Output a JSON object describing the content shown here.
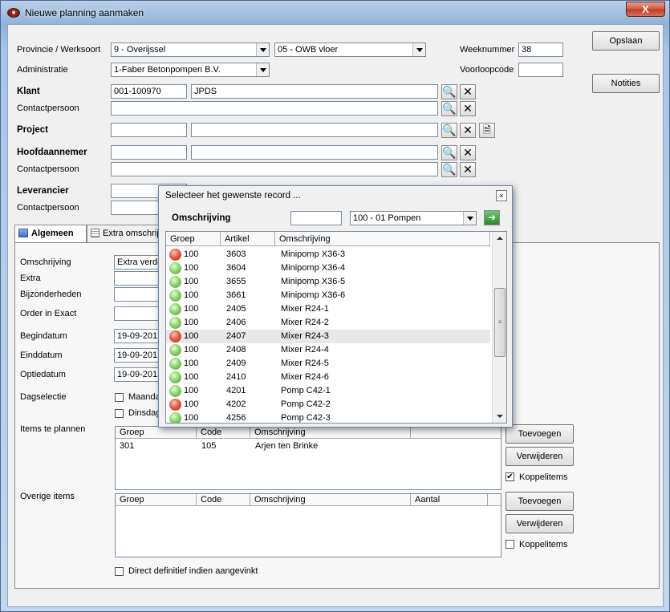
{
  "window": {
    "title": "Nieuwe planning aanmaken",
    "close": "X"
  },
  "form": {
    "provincie_label": "Provincie / Werksoort",
    "provincie_value": "9 - Overijssel",
    "werksoort_value": "05 - OWB vloer",
    "weeknummer_label": "Weeknummer",
    "weeknummer_value": "38",
    "administratie_label": "Administratie",
    "administratie_value": "1-Faber Betonpompen B.V.",
    "voorloopcode_label": "Voorloopcode",
    "klant_label": "Klant",
    "klant_code": "001-100970",
    "klant_name": "JPDS",
    "contactpersoon_label": "Contactpersoon",
    "project_label": "Project",
    "hoofdaannemer_label": "Hoofdaannemer",
    "leverancier_label": "Leverancier"
  },
  "side_buttons": {
    "opslaan": "Opslaan",
    "notities": "Notities"
  },
  "tabs": [
    {
      "label": "Algemeen"
    },
    {
      "label": "Extra omschrijv"
    }
  ],
  "general": {
    "omschrijving_label": "Omschrijving",
    "omschrijving_value": "Extra verdie",
    "extra_label": "Extra",
    "bijzonderheden_label": "Bijzonderheden",
    "order_label": "Order in Exact",
    "begindatum_label": "Begindatum",
    "begindatum_value": "19-09-2012",
    "einddatum_label": "Einddatum",
    "einddatum_value": "19-09-2012",
    "optiedatum_label": "Optiedatum",
    "optiedatum_value": "19-09-2012",
    "dagselectie_label": "Dagselectie",
    "maandag": "Maandag",
    "dinsdag": "Dinsdag",
    "items_label": "Items te plannen",
    "overige_label": "Overige items",
    "direct_label": "Direct definitief indien aangevinkt"
  },
  "items_grid": {
    "columns": [
      "Groep",
      "Code",
      "Omschrijving"
    ],
    "rows": [
      {
        "groep": "301",
        "code": "105",
        "omschrijving": "Arjen ten Brinke"
      }
    ]
  },
  "overige_grid": {
    "columns": [
      "Groep",
      "Code",
      "Omschrijving",
      "Aantal"
    ]
  },
  "grid_buttons": {
    "toevoegen": "Toevoegen",
    "verwijderen": "Verwijderen",
    "koppelitems": "Koppelitems"
  },
  "dialog": {
    "title": "Selecteer het gewenste record ...",
    "close": "×",
    "filter_label": "Omschrijving",
    "filter_combo": "100 - 01 Pompen",
    "columns": [
      "Groep",
      "Artikel",
      "Omschrijving"
    ],
    "rows": [
      {
        "status": "red",
        "groep": "100",
        "artikel": "3603",
        "omschrijving": "Minipomp X36-3"
      },
      {
        "status": "green",
        "groep": "100",
        "artikel": "3604",
        "omschrijving": "Minipomp X36-4"
      },
      {
        "status": "green",
        "groep": "100",
        "artikel": "3655",
        "omschrijving": "Minipomp X36-5"
      },
      {
        "status": "green",
        "groep": "100",
        "artikel": "3661",
        "omschrijving": "Minipomp X36-6"
      },
      {
        "status": "green",
        "groep": "100",
        "artikel": "2405",
        "omschrijving": "Mixer R24-1"
      },
      {
        "status": "green",
        "groep": "100",
        "artikel": "2406",
        "omschrijving": "Mixer R24-2"
      },
      {
        "status": "red",
        "groep": "100",
        "artikel": "2407",
        "omschrijving": "Mixer R24-3"
      },
      {
        "status": "green",
        "groep": "100",
        "artikel": "2408",
        "omschrijving": "Mixer R24-4"
      },
      {
        "status": "green",
        "groep": "100",
        "artikel": "2409",
        "omschrijving": "Mixer R24-5"
      },
      {
        "status": "green",
        "groep": "100",
        "artikel": "2410",
        "omschrijving": "Mixer R24-6"
      },
      {
        "status": "green",
        "groep": "100",
        "artikel": "4201",
        "omschrijving": "Pomp C42-1"
      },
      {
        "status": "red",
        "groep": "100",
        "artikel": "4202",
        "omschrijving": "Pomp C42-2"
      },
      {
        "status": "green",
        "groep": "100",
        "artikel": "4256",
        "omschrijving": "Pomp C42-3"
      }
    ]
  }
}
